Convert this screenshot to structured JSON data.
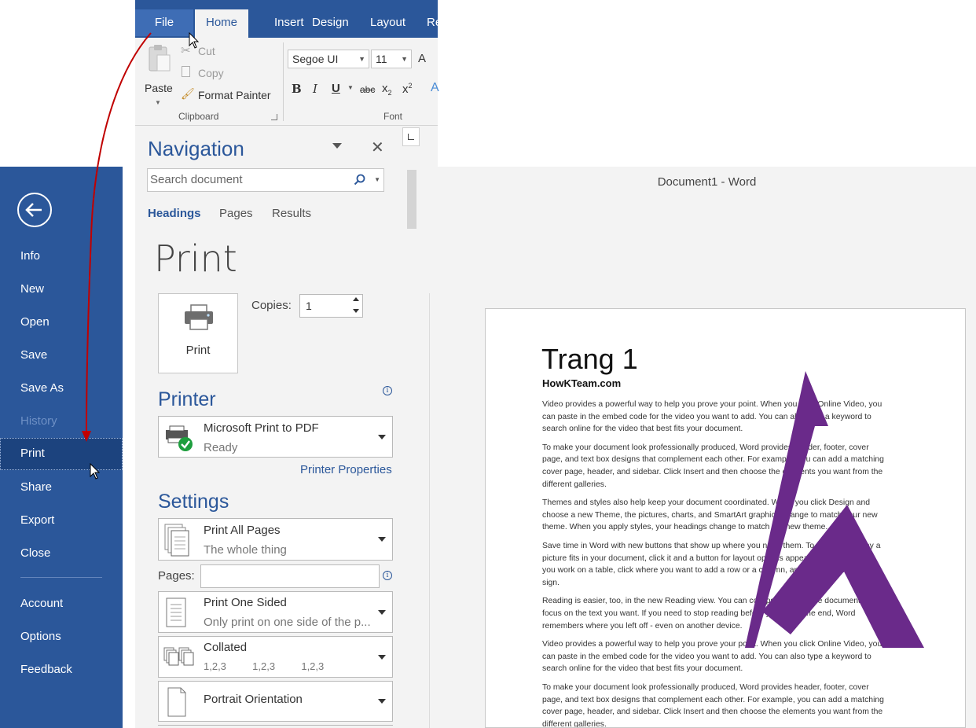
{
  "ribbon": {
    "tabs": [
      "File",
      "Home",
      "Insert",
      "Design",
      "Layout",
      "Re"
    ],
    "clipboard": {
      "paste": "Paste",
      "cut": "Cut",
      "copy": "Copy",
      "format_painter": "Format Painter",
      "group_label": "Clipboard"
    },
    "font": {
      "font_name": "Segoe UI",
      "font_size": "11",
      "grow_font": "A",
      "bold": "B",
      "italic": "I",
      "underline": "U",
      "strikethrough": "abc",
      "subscript": "x",
      "subscript_mark": "2",
      "superscript": "x",
      "superscript_mark": "2",
      "group_label": "Font"
    }
  },
  "navigation": {
    "title": "Navigation",
    "search_placeholder": "Search document",
    "tabs": [
      "Headings",
      "Pages",
      "Results"
    ]
  },
  "window": {
    "title": "Document1 - Word"
  },
  "backstage": {
    "menu": [
      {
        "label": "Info"
      },
      {
        "label": "New"
      },
      {
        "label": "Open"
      },
      {
        "label": "Save"
      },
      {
        "label": "Save As"
      },
      {
        "label": "History"
      },
      {
        "label": "Print"
      },
      {
        "label": "Share"
      },
      {
        "label": "Export"
      },
      {
        "label": "Close"
      },
      {
        "label": "Account"
      },
      {
        "label": "Options"
      },
      {
        "label": "Feedback"
      }
    ]
  },
  "print": {
    "heading": "Print",
    "button_label": "Print",
    "copies_label": "Copies:",
    "copies_value": "1",
    "printer_heading": "Printer",
    "printer_name": "Microsoft Print to PDF",
    "printer_status": "Ready",
    "printer_properties": "Printer Properties",
    "settings_heading": "Settings",
    "print_range": "Print All Pages",
    "print_range_desc": "The whole thing",
    "pages_label": "Pages:",
    "sided": "Print One Sided",
    "sided_desc": "Only print on one side of the p...",
    "collation": "Collated",
    "collation_desc": [
      "1,2,3",
      "1,2,3",
      "1,2,3"
    ],
    "orientation": "Portrait Orientation"
  },
  "preview": {
    "heading": "Trang 1",
    "subtitle": "HowKTeam.com",
    "paragraphs": [
      [
        "Video provides a powerful way to help you prove your point. When you click Online Video, you",
        "can paste in the embed code for the video you want to add. You can also type a keyword to",
        "search online for the video that best fits your document."
      ],
      [
        "To make your document look professionally produced, Word provides header, footer, cover",
        "page, and text box designs that complement each other. For example, you can add a matching",
        "cover page, header, and sidebar. Click Insert and then choose the elements you want from the",
        "different galleries."
      ],
      [
        "Themes and styles also help keep your document coordinated. When you click Design and",
        "choose a new Theme, the pictures, charts, and SmartArt graphics change to match your new",
        "theme. When you apply styles, your headings change to match the new theme."
      ],
      [
        "Save time in Word with new buttons that show up where you need them. To change the way a",
        "picture fits in your document, click it and a button for layout options appears next to it. When",
        "you work on a table, click where you want to add a row or a column, and then click the plus",
        "sign."
      ],
      [
        "Reading is easier, too, in the new Reading view. You can collapse parts of the document and",
        "focus on the text you want. If you need to stop reading before you reach the end, Word",
        "remembers where you left off - even on another device."
      ],
      [
        "Video provides a powerful way to help you prove your point. When you click Online Video, you",
        "can paste in the embed code for the video you want to add. You can also type a keyword to",
        "search online for the video that best fits your document."
      ],
      [
        "To make your document look professionally produced, Word provides header, footer, cover",
        "page, and text box designs that complement each other. For example, you can add a matching",
        "cover page, header, and sidebar. Click Insert and then choose the elements you want from the",
        "different galleries."
      ]
    ]
  },
  "colors": {
    "word_blue": "#2b579a",
    "selected_menu": "#1c437e",
    "watermark_purple": "#6a2a8a",
    "annotation_arrow": "#c00000",
    "status_green": "#1e9e3e"
  }
}
